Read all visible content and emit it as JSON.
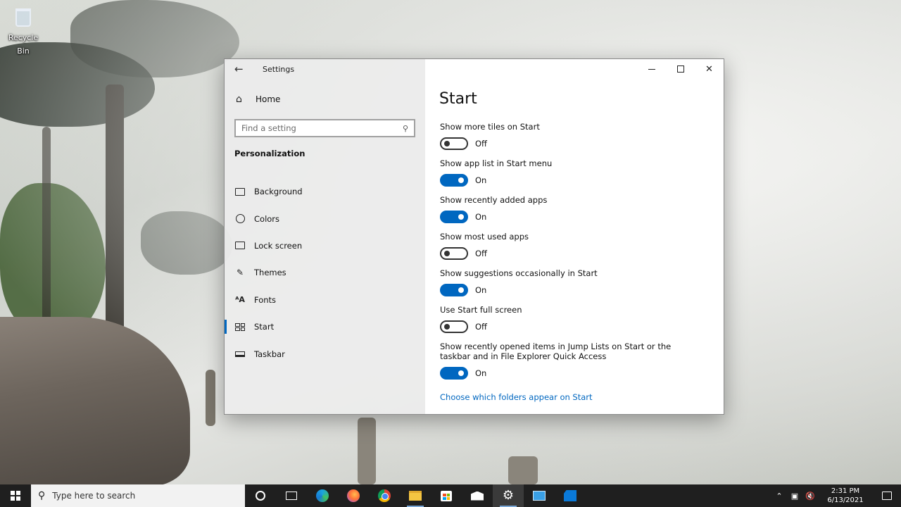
{
  "desktop": {
    "icons": [
      {
        "label": "Recycle Bin",
        "icon": "recycle-bin-icon"
      }
    ]
  },
  "window": {
    "title": "Settings",
    "controls": {
      "minimize_icon": "minimize-icon",
      "maximize_icon": "maximize-icon",
      "close_icon": "close-icon"
    }
  },
  "sidebar": {
    "home_label": "Home",
    "search_placeholder": "Find a setting",
    "section_title": "Personalization",
    "items": [
      {
        "label": "Background",
        "icon": "picture-icon",
        "active": false
      },
      {
        "label": "Colors",
        "icon": "palette-icon",
        "active": false
      },
      {
        "label": "Lock screen",
        "icon": "lock-screen-icon",
        "active": false
      },
      {
        "label": "Themes",
        "icon": "brush-icon",
        "active": false
      },
      {
        "label": "Fonts",
        "icon": "font-icon",
        "active": false
      },
      {
        "label": "Start",
        "icon": "start-tiles-icon",
        "active": true
      },
      {
        "label": "Taskbar",
        "icon": "taskbar-icon",
        "active": false
      }
    ]
  },
  "main": {
    "page_title": "Start",
    "options": [
      {
        "label": "Show more tiles on Start",
        "state": "Off",
        "on": false
      },
      {
        "label": "Show app list in Start menu",
        "state": "On",
        "on": true
      },
      {
        "label": "Show recently added apps",
        "state": "On",
        "on": true
      },
      {
        "label": "Show most used apps",
        "state": "Off",
        "on": false
      },
      {
        "label": "Show suggestions occasionally in Start",
        "state": "On",
        "on": true
      },
      {
        "label": "Use Start full screen",
        "state": "Off",
        "on": false
      },
      {
        "label": "Show recently opened items in Jump Lists on Start or the taskbar and in File Explorer Quick Access",
        "state": "On",
        "on": true
      }
    ],
    "link_label": "Choose which folders appear on Start"
  },
  "taskbar": {
    "search_placeholder": "Type here to search",
    "apps": [
      {
        "name": "cortana",
        "icon": "cortana-icon"
      },
      {
        "name": "task-view",
        "icon": "task-view-icon"
      },
      {
        "name": "edge",
        "icon": "edge-icon"
      },
      {
        "name": "firefox",
        "icon": "firefox-icon"
      },
      {
        "name": "chrome",
        "icon": "chrome-icon"
      },
      {
        "name": "file-explorer",
        "icon": "folder-icon"
      },
      {
        "name": "store",
        "icon": "store-icon"
      },
      {
        "name": "mail",
        "icon": "mail-icon"
      },
      {
        "name": "settings",
        "icon": "gear-icon"
      },
      {
        "name": "remote-desktop",
        "icon": "remote-desktop-icon"
      },
      {
        "name": "visual-studio",
        "icon": "visual-studio-icon"
      }
    ],
    "time": "2:31 PM",
    "date": "6/13/2021"
  },
  "colors": {
    "accent": "#0067c0",
    "taskbar": "#1f1f1f"
  }
}
